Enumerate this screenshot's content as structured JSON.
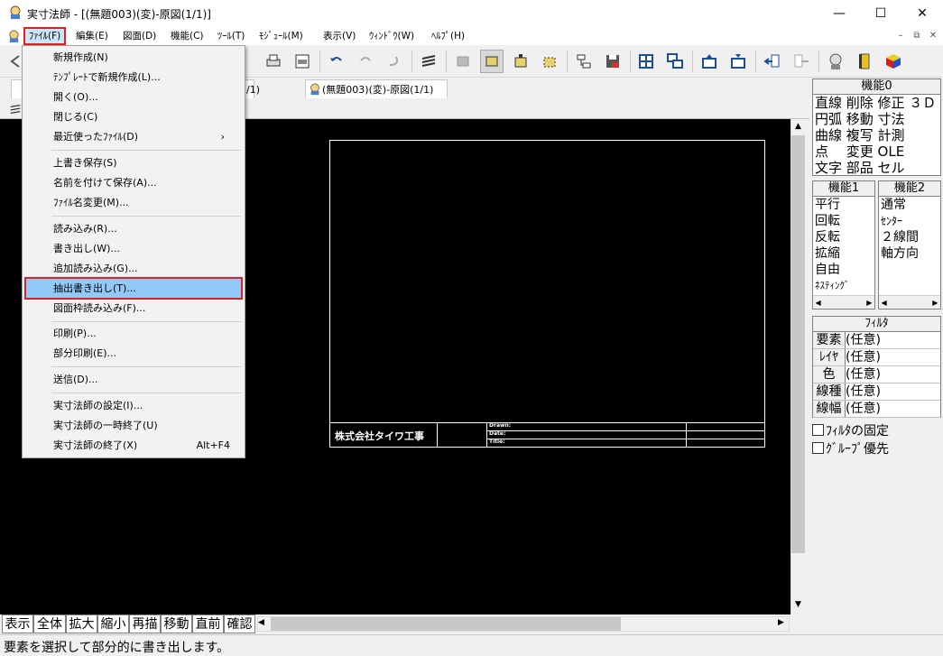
{
  "window": {
    "title": "実寸法師 - [(無題003)(変)-原図(1/1)]",
    "minimize": "—",
    "maximize": "☐",
    "close": "✕"
  },
  "menubar": {
    "items": [
      "ﾌｧｲﾙ(F)",
      "編集(E)",
      "図面(D)",
      "機能(C)",
      "ﾂｰﾙ(T)",
      "ﾓｼﾞｭｰﾙ(M)",
      "表示(V)",
      "ｳｨﾝﾄﾞｳ(W)",
      "ﾍﾙﾌﾟ(H)"
    ],
    "mdi_min": "–",
    "mdi_restore": "⧉",
    "mdi_close": "✕"
  },
  "tabs": {
    "tab1_partial": "/1)",
    "tab2": "(無題003)(変)-原図(1/1)"
  },
  "file_menu": {
    "items": [
      {
        "label": "新規作成(N)"
      },
      {
        "label": "ﾃﾝﾌﾟﾚｰﾄで新規作成(L)..."
      },
      {
        "label": "開く(O)..."
      },
      {
        "label": "閉じる(C)"
      },
      {
        "label": "最近使ったﾌｧｲﾙ(D)",
        "submenu": "›"
      },
      {
        "label": "上書き保存(S)"
      },
      {
        "label": "名前を付けて保存(A)..."
      },
      {
        "label": "ﾌｧｲﾙ名変更(M)..."
      },
      {
        "label": "読み込み(R)..."
      },
      {
        "label": "書き出し(W)..."
      },
      {
        "label": "追加読み込み(G)..."
      },
      {
        "label": "抽出書き出し(T)...",
        "highlighted": true
      },
      {
        "label": "図面枠読み込み(F)..."
      },
      {
        "label": "印刷(P)..."
      },
      {
        "label": "部分印刷(E)..."
      },
      {
        "label": "送信(D)..."
      },
      {
        "label": "実寸法師の設定(I)..."
      },
      {
        "label": "実寸法師の一時終了(U)"
      },
      {
        "label": "実寸法師の終了(X)",
        "shortcut": "Alt+F4"
      }
    ]
  },
  "panel0": {
    "title": "機能0",
    "rows": [
      "直線 削除 修正 ３Ｄ",
      "円弧 移動 寸法",
      "曲線 複写 計測",
      "点　 変更 OLE",
      "文字 部品 セル"
    ]
  },
  "panel1": {
    "title": "機能1",
    "items": [
      "平行",
      "回転",
      "反転",
      "拡縮",
      "自由",
      "ﾈｽﾃｨﾝｸﾞ"
    ]
  },
  "panel2": {
    "title": "機能2",
    "items": [
      "通常",
      "ｾﾝﾀｰ",
      "２線間",
      "軸方向"
    ]
  },
  "filter": {
    "title": "ﾌｨﾙﾀ",
    "rows": [
      {
        "key": "要素",
        "value": "(任意)"
      },
      {
        "key": "ﾚｲﾔ",
        "value": "(任意)"
      },
      {
        "key": "色",
        "value": "(任意)"
      },
      {
        "key": "線種",
        "value": "(任意)"
      },
      {
        "key": "線幅",
        "value": "(任意)"
      }
    ],
    "fix_label": "ﾌｨﾙﾀの固定",
    "group_label": "ｸﾞﾙｰﾌﾟ優先"
  },
  "bottom_buttons": [
    "表示",
    "全体",
    "拡大",
    "縮小",
    "再描",
    "移動",
    "直前",
    "確認"
  ],
  "drawing": {
    "company": "株式会社タイワ工事",
    "title_fields": [
      "Drawn:",
      "Date:",
      "Title:"
    ]
  },
  "status": {
    "text": "要素を選択して部分的に書き出します。"
  },
  "colors": {
    "highlight": "#91c9f7",
    "accent_red": "#e02020"
  }
}
